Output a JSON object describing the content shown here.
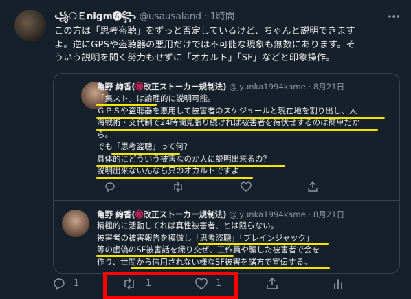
{
  "main_tweet": {
    "display_name": "꧁❍Ｅnigm🅐꧂",
    "handle": "@usausaland",
    "separator": "·",
    "time": "1時間",
    "lines": [
      "この方は「思考盗聴」をずっと否定しているけど、ちゃんと説明できます",
      "よ。逆にGPSや盗聴器の悪用だけでは不可能な現象も無数にあります。そ",
      "ういう説明を聞く努力もせずに「オカルト」「SF」などと印象操作。"
    ],
    "more_icon": "more-horizontal-icon"
  },
  "quoted_1": {
    "name_part1": "亀野 絢香(",
    "emoji": "㊗",
    "name_part2": "改正ストーカー規制法)",
    "handle": "@jyunka1994kame",
    "separator": "·",
    "date": "8月21日",
    "lines": [
      "「集スト」は論理的に説明可能。",
      "ＧＰＳや盗聴器を悪用して被害者のスケジュールと現在地を割り出し、人",
      "海戦術・交代制で24時間見張り続ければ被害者を待伏せするのは簡単だか",
      "ら。",
      "でも「思考盗聴」って何？",
      "具体的にどういう被害なのか人に説明出来るの？",
      "説明出来ないんなら只のオカルトですよ"
    ],
    "actions": [
      {
        "icon": "reply-icon",
        "count": ""
      },
      {
        "icon": "retweet-icon",
        "count": ""
      },
      {
        "icon": "like-icon",
        "count": ""
      },
      {
        "icon": "share-icon",
        "count": ""
      }
    ]
  },
  "quoted_2": {
    "name_part1": "亀野 絢香(",
    "emoji": "㊗",
    "name_part2": "改正ストーカー規制法)",
    "handle": "@jyunka1994kame",
    "separator": "·",
    "date": "8月21日",
    "lines": [
      "精極的に活動してれば真性被害者、とは限らない。",
      "被害者の被害報告を模倣し「思考盗聴」「ブレインジャック」",
      "等の虚偽のSF被害話を織り交ぜ、工作員や騙した被害者で会を",
      "作り、世間から信用されない様なSF被害を諸方で宣伝する。"
    ]
  },
  "actions": {
    "reply_count": "1",
    "retweet_count": "1",
    "like_count": "1",
    "icons": [
      "reply-icon",
      "retweet-icon",
      "like-icon",
      "share-icon",
      "analytics-icon"
    ]
  },
  "colors": {
    "background": "#15202b",
    "text": "#e7e9ea",
    "muted": "#8b98a5",
    "border": "#38444d",
    "underline": "#f2e600",
    "highlight_box": "#ff0000"
  }
}
